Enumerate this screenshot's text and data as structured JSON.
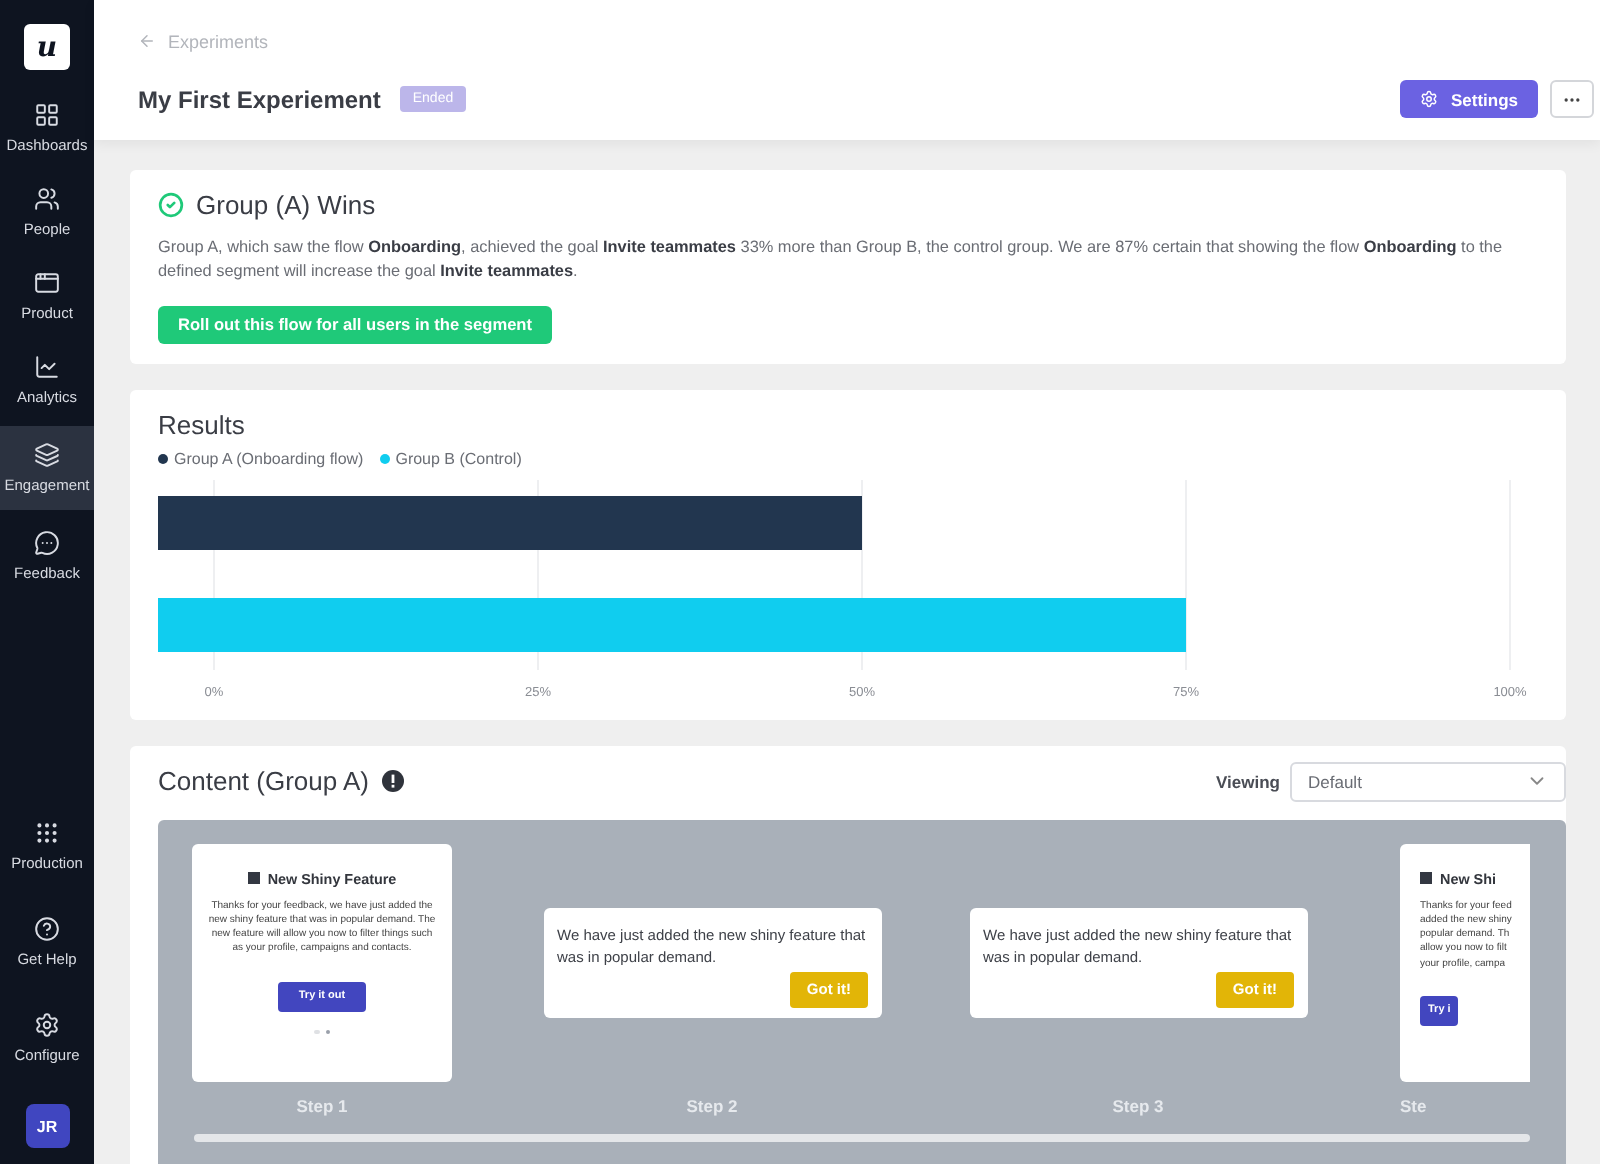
{
  "sidebar": {
    "logo": "u",
    "top_items": [
      {
        "label": "Dashboards",
        "selected": false
      },
      {
        "label": "People",
        "selected": false
      },
      {
        "label": "Product",
        "selected": false
      },
      {
        "label": "Analytics",
        "selected": false
      },
      {
        "label": "Engagement",
        "selected": true
      },
      {
        "label": "Feedback",
        "selected": false
      }
    ],
    "bottom_items": [
      {
        "label": "Production",
        "selected": false
      },
      {
        "label": "Get Help",
        "selected": false
      },
      {
        "label": "Configure",
        "selected": false
      }
    ],
    "avatar": "JR"
  },
  "header": {
    "breadcrumb": "Experiments",
    "title": "My First Experiement",
    "status": "Ended",
    "settings_button": "Settings"
  },
  "winner": {
    "title": "Group (A) Wins",
    "text": "Group A, which saw the flow **Onboarding**, achieved the goal **Invite teammates** 33% more than Group B, the control group. We are 87% certain that showing the flow **Onboarding** to the defined segment will increase the goal **Invite teammates**.",
    "button": "Roll out this flow for all users in the segment"
  },
  "results": {
    "title": "Results",
    "chart_data": {
      "type": "bar",
      "orientation": "horizontal",
      "grid": true,
      "series": [
        {
          "name": "Group A (Onboarding flow)",
          "color": "#22364f",
          "values": [
            50
          ]
        },
        {
          "name": "Group B (Control)",
          "color": "#10cdef",
          "values": [
            75
          ]
        }
      ],
      "xlim": [
        0,
        100
      ],
      "xticks": [
        {
          "value": 0,
          "label": "0%"
        },
        {
          "value": 25,
          "label": "25%"
        },
        {
          "value": 50,
          "label": "50%"
        },
        {
          "value": 75,
          "label": "75%"
        },
        {
          "value": 100,
          "label": "100%"
        }
      ]
    }
  },
  "content": {
    "title": "Content (Group A)",
    "viewing_label": "Viewing",
    "viewing_value": "Default",
    "steps": [
      {
        "kind": "modal",
        "label": "Step 1",
        "title": "New Shiny Feature",
        "body": "Thanks for your feedback, we have just added the new shiny feature that was in popular demand. The new feature will allow you now to filter things such as your profile, campaigns and contacts.",
        "button": "Try it out",
        "dots": [
          {
            "selected": false
          },
          {
            "selected": true
          }
        ]
      },
      {
        "kind": "tooltip",
        "label": "Step 2",
        "body": "We have just added the new shiny feature that was in popular demand.",
        "button": "Got it!"
      },
      {
        "kind": "tooltip",
        "label": "Step 3",
        "body": "We have just added the new shiny feature that was in popular demand.",
        "button": "Got it!"
      },
      {
        "kind": "modal_partial",
        "label": "Ste",
        "title": "New Shi",
        "body_lines": [
          "Thanks for your feed",
          "added the new shiny",
          "popular demand. Th",
          "allow you now to filt",
          "your profile, campa"
        ],
        "button": "Try i"
      }
    ]
  }
}
